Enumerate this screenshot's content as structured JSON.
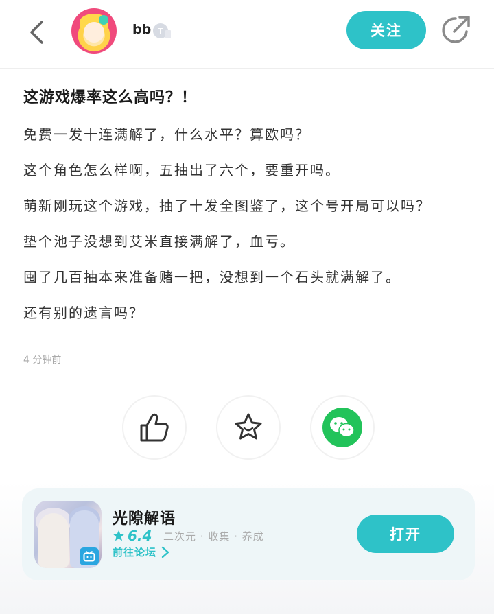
{
  "header": {
    "username": "bb",
    "follow_label": "关注"
  },
  "post": {
    "title": "这游戏爆率这么高吗？！",
    "lines": [
      "免费一发十连满解了，什么水平？算欧吗？",
      "这个角色怎么样啊，五抽出了六个，要重开吗。",
      "萌新刚玩这个游戏，抽了十发全图鉴了，这个号开局可以吗？",
      "垫个池子没想到艾米直接满解了，血亏。",
      "囤了几百抽本来准备赌一把，没想到一个石头就满解了。",
      "还有别的遗言吗？"
    ],
    "time": "4 分钟前"
  },
  "actions": {
    "like_icon": "thumbs-up-icon",
    "favorite_icon": "star-icon",
    "share_icon": "wechat-icon"
  },
  "game_card": {
    "name": "光隙解语",
    "rating": "6.4",
    "tags": "二次元 · 收集 · 养成",
    "forum_link": "前往论坛",
    "open_label": "打开"
  },
  "colors": {
    "accent": "#2ec2c8",
    "wechat": "#22c35a"
  }
}
